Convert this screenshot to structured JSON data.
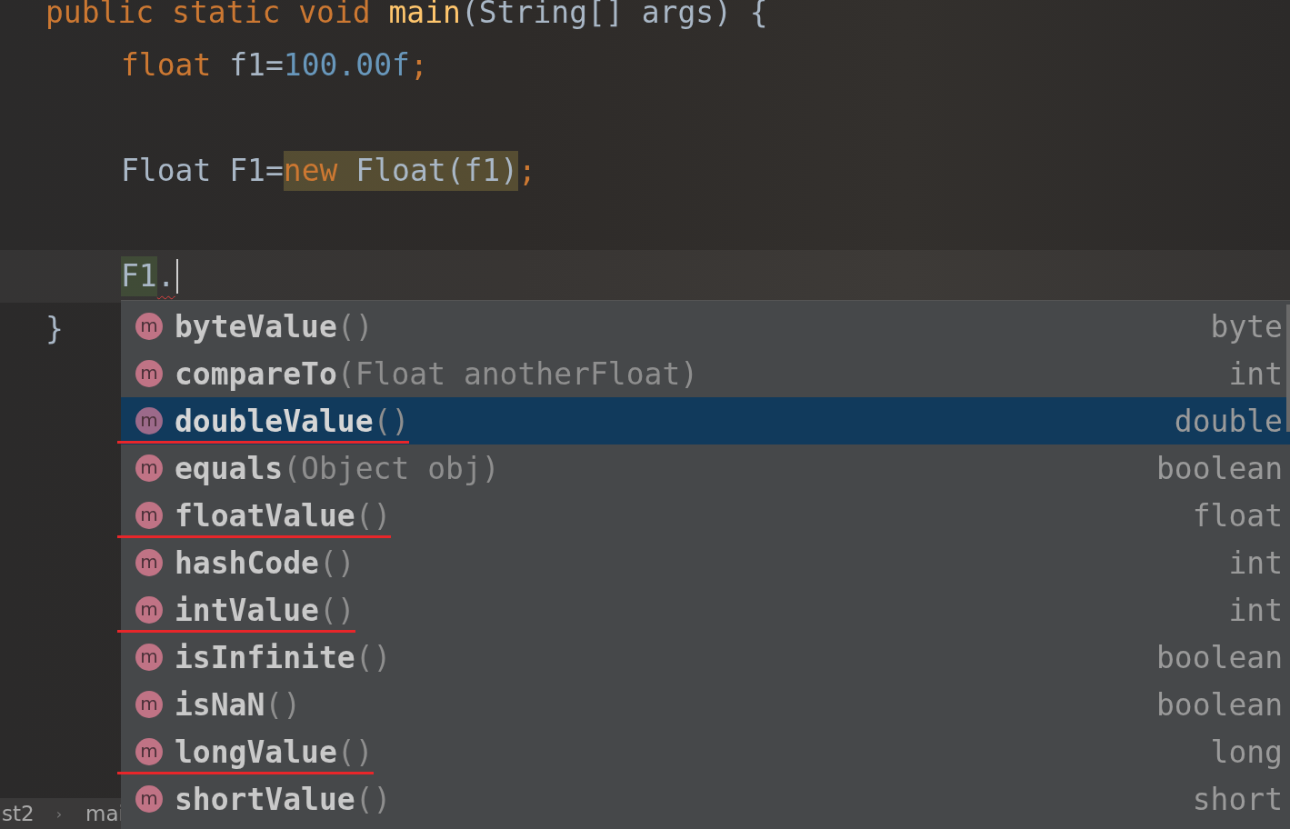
{
  "editor": {
    "lines": [
      {
        "indented": false,
        "current": false,
        "tokens": [
          {
            "text": "public static void ",
            "kind": "keyword"
          },
          {
            "text": "main",
            "kind": "method"
          },
          {
            "text": "(String[] args) {",
            "kind": "plain"
          }
        ]
      },
      {
        "indented": true,
        "current": false,
        "tokens": [
          {
            "text": "float ",
            "kind": "keyword"
          },
          {
            "text": "f1=",
            "kind": "plain"
          },
          {
            "text": "100.00f",
            "kind": "number"
          },
          {
            "text": ";",
            "kind": "keyword"
          }
        ]
      },
      {
        "current": false
      },
      {
        "indented": true,
        "current": false,
        "tokens": [
          {
            "text": "Float F1=",
            "kind": "plain"
          },
          {
            "text": "new",
            "kind": "keyword",
            "highlighted": true
          },
          {
            "text": " Float(f1)",
            "kind": "plain",
            "highlighted": true
          },
          {
            "text": ";",
            "kind": "keyword"
          }
        ]
      },
      {
        "current": false
      },
      {
        "indented": true,
        "current": true,
        "tokens": [
          {
            "text": "F1",
            "kind": "plain",
            "usage": true
          },
          {
            "text": ".",
            "kind": "plain",
            "error": true
          }
        ]
      },
      {
        "indented": false,
        "current": false,
        "tokens": [
          {
            "text": "}",
            "kind": "plain"
          }
        ]
      }
    ]
  },
  "breadcrumbs": [
    "st2",
    "›",
    "mai"
  ],
  "completion": {
    "items": [
      {
        "icon": "m",
        "name": "byteValue",
        "params": "()",
        "type": "byte",
        "selected": false,
        "underlined": false
      },
      {
        "icon": "m",
        "name": "compareTo",
        "params": "(Float anotherFloat)",
        "type": "int",
        "selected": false,
        "underlined": false
      },
      {
        "icon": "m",
        "name": "doubleValue",
        "params": "()",
        "type": "double",
        "selected": true,
        "underlined": true
      },
      {
        "icon": "m",
        "name": "equals",
        "params": "(Object obj)",
        "type": "boolean",
        "selected": false,
        "underlined": false
      },
      {
        "icon": "m",
        "name": "floatValue",
        "params": "()",
        "type": "float",
        "selected": false,
        "underlined": true
      },
      {
        "icon": "m",
        "name": "hashCode",
        "params": "()",
        "type": "int",
        "selected": false,
        "underlined": false
      },
      {
        "icon": "m",
        "name": "intValue",
        "params": "()",
        "type": "int",
        "selected": false,
        "underlined": true
      },
      {
        "icon": "m",
        "name": "isInfinite",
        "params": "()",
        "type": "boolean",
        "selected": false,
        "underlined": false
      },
      {
        "icon": "m",
        "name": "isNaN",
        "params": "()",
        "type": "boolean",
        "selected": false,
        "underlined": false
      },
      {
        "icon": "m",
        "name": "longValue",
        "params": "()",
        "type": "long",
        "selected": false,
        "underlined": true
      },
      {
        "icon": "m",
        "name": "shortValue",
        "params": "()",
        "type": "short",
        "selected": false,
        "underlined": false
      }
    ]
  }
}
